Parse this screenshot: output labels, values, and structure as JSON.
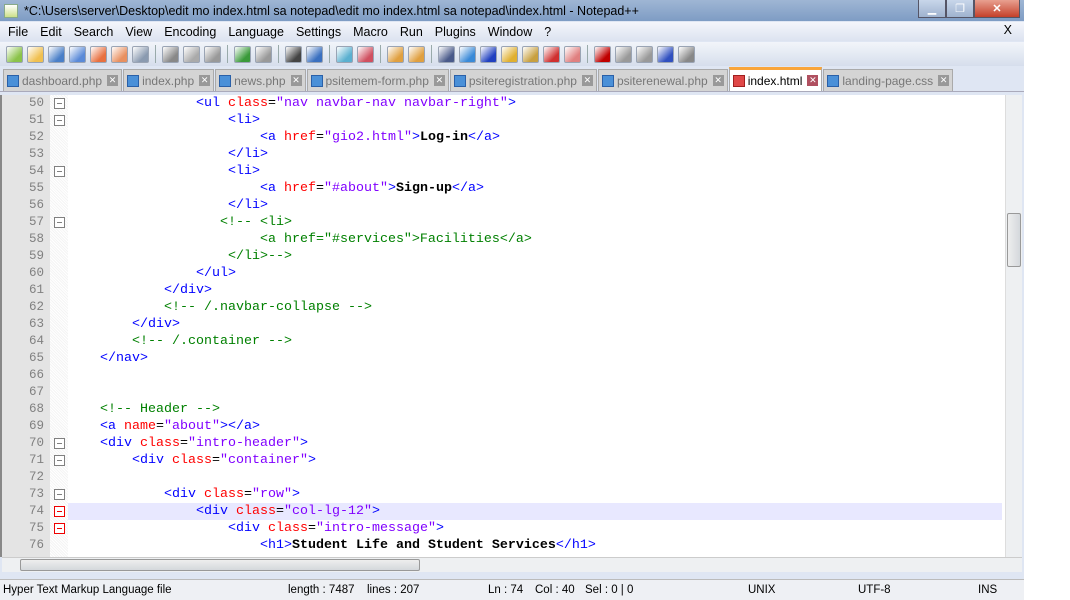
{
  "window": {
    "title": "*C:\\Users\\server\\Desktop\\edit mo index.html sa notepad\\edit mo index.html sa notepad\\index.html - Notepad++",
    "min": "▁",
    "max": "❐",
    "close": "✕"
  },
  "menu": [
    "File",
    "Edit",
    "Search",
    "View",
    "Encoding",
    "Language",
    "Settings",
    "Macro",
    "Run",
    "Plugins",
    "Window",
    "?"
  ],
  "menu_close": "X",
  "toolbar": [
    "new-file-icon",
    "open-file-icon",
    "save-icon",
    "save-all-icon",
    "close-icon",
    "close-all-icon",
    "print-icon",
    "|",
    "cut-icon",
    "copy-icon",
    "paste-icon",
    "|",
    "undo-icon",
    "redo-icon",
    "|",
    "find-icon",
    "replace-icon",
    "|",
    "zoom-in-icon",
    "zoom-out-icon",
    "|",
    "sync-vertical-icon",
    "sync-horizontal-icon",
    "|",
    "word-wrap-icon",
    "show-all-chars-icon",
    "indent-guide-icon",
    "user-lang-icon",
    "doc-map-icon",
    "function-list-icon",
    "folder-workspace-icon",
    "|",
    "record-macro-icon",
    "stop-record-icon",
    "play-macro-icon",
    "run-macro-multiple-icon",
    "save-macro-icon"
  ],
  "tabs": [
    {
      "label": "dashboard.php"
    },
    {
      "label": "index.php"
    },
    {
      "label": "news.php"
    },
    {
      "label": "psitemem-form.php"
    },
    {
      "label": "psiteregistration.php"
    },
    {
      "label": "psiterenewal.php"
    },
    {
      "label": "index.html",
      "active": true
    },
    {
      "label": "landing-page.css"
    }
  ],
  "editor": {
    "current_line": 74,
    "lines": [
      {
        "n": "50",
        "f": "m",
        "s": [
          [
            "e",
            "                "
          ],
          [
            "t",
            "<ul "
          ],
          [
            "a",
            "class"
          ],
          [
            "e",
            "="
          ],
          [
            "v",
            "\"nav navbar-nav navbar-right\""
          ],
          [
            "t",
            ">"
          ]
        ]
      },
      {
        "n": "51",
        "f": "m",
        "s": [
          [
            "e",
            "                    "
          ],
          [
            "t",
            "<li>"
          ]
        ]
      },
      {
        "n": "52",
        "f": "",
        "s": [
          [
            "e",
            "                        "
          ],
          [
            "t",
            "<a "
          ],
          [
            "a",
            "href"
          ],
          [
            "e",
            "="
          ],
          [
            "v",
            "\"gio2.html\""
          ],
          [
            "t",
            ">"
          ],
          [
            "x",
            "Log-in"
          ],
          [
            "t",
            "</a>"
          ]
        ]
      },
      {
        "n": "53",
        "f": "",
        "s": [
          [
            "e",
            "                    "
          ],
          [
            "t",
            "</li>"
          ]
        ]
      },
      {
        "n": "54",
        "f": "m",
        "s": [
          [
            "e",
            "                    "
          ],
          [
            "t",
            "<li>"
          ]
        ]
      },
      {
        "n": "55",
        "f": "",
        "s": [
          [
            "e",
            "                        "
          ],
          [
            "t",
            "<a "
          ],
          [
            "a",
            "href"
          ],
          [
            "e",
            "="
          ],
          [
            "v",
            "\"#about\""
          ],
          [
            "t",
            ">"
          ],
          [
            "x",
            "Sign-up"
          ],
          [
            "t",
            "</a>"
          ]
        ]
      },
      {
        "n": "56",
        "f": "",
        "s": [
          [
            "e",
            "                    "
          ],
          [
            "t",
            "</li>"
          ]
        ]
      },
      {
        "n": "57",
        "f": "m",
        "s": [
          [
            "e",
            "                   "
          ],
          [
            "c",
            "<!-- <li>"
          ]
        ]
      },
      {
        "n": "58",
        "f": "",
        "s": [
          [
            "e",
            "                        "
          ],
          [
            "c",
            "<a href=\"#services\">Facilities</a>"
          ]
        ]
      },
      {
        "n": "59",
        "f": "",
        "s": [
          [
            "e",
            "                    "
          ],
          [
            "c",
            "</li>-->"
          ]
        ]
      },
      {
        "n": "60",
        "f": "",
        "s": [
          [
            "e",
            "                "
          ],
          [
            "t",
            "</ul>"
          ]
        ]
      },
      {
        "n": "61",
        "f": "",
        "s": [
          [
            "e",
            "            "
          ],
          [
            "t",
            "</div>"
          ]
        ]
      },
      {
        "n": "62",
        "f": "",
        "s": [
          [
            "e",
            "            "
          ],
          [
            "c",
            "<!-- /.navbar-collapse -->"
          ]
        ]
      },
      {
        "n": "63",
        "f": "",
        "s": [
          [
            "e",
            "        "
          ],
          [
            "t",
            "</div>"
          ]
        ]
      },
      {
        "n": "64",
        "f": "",
        "s": [
          [
            "e",
            "        "
          ],
          [
            "c",
            "<!-- /.container -->"
          ]
        ]
      },
      {
        "n": "65",
        "f": "",
        "s": [
          [
            "e",
            "    "
          ],
          [
            "t",
            "</nav>"
          ]
        ]
      },
      {
        "n": "66",
        "f": "",
        "s": []
      },
      {
        "n": "67",
        "f": "",
        "s": []
      },
      {
        "n": "68",
        "f": "",
        "s": [
          [
            "e",
            "    "
          ],
          [
            "c",
            "<!-- Header -->"
          ]
        ]
      },
      {
        "n": "69",
        "f": "",
        "s": [
          [
            "e",
            "    "
          ],
          [
            "t",
            "<a "
          ],
          [
            "a",
            "name"
          ],
          [
            "e",
            "="
          ],
          [
            "v",
            "\"about\""
          ],
          [
            "t",
            "></a>"
          ]
        ]
      },
      {
        "n": "70",
        "f": "m",
        "s": [
          [
            "e",
            "    "
          ],
          [
            "t",
            "<div "
          ],
          [
            "a",
            "class"
          ],
          [
            "e",
            "="
          ],
          [
            "v",
            "\"intro-header\""
          ],
          [
            "t",
            ">"
          ]
        ]
      },
      {
        "n": "71",
        "f": "m",
        "s": [
          [
            "e",
            "        "
          ],
          [
            "t",
            "<div "
          ],
          [
            "a",
            "class"
          ],
          [
            "e",
            "="
          ],
          [
            "v",
            "\"container\""
          ],
          [
            "t",
            ">"
          ]
        ]
      },
      {
        "n": "72",
        "f": "",
        "s": []
      },
      {
        "n": "73",
        "f": "m",
        "s": [
          [
            "e",
            "            "
          ],
          [
            "t",
            "<div "
          ],
          [
            "a",
            "class"
          ],
          [
            "e",
            "="
          ],
          [
            "v",
            "\"row\""
          ],
          [
            "t",
            ">"
          ]
        ]
      },
      {
        "n": "74",
        "f": "r",
        "s": [
          [
            "e",
            "                "
          ],
          [
            "t",
            "<div "
          ],
          [
            "a",
            "class"
          ],
          [
            "e",
            "="
          ],
          [
            "v",
            "\"col-lg-12\""
          ],
          [
            "t",
            ">"
          ]
        ]
      },
      {
        "n": "75",
        "f": "r",
        "s": [
          [
            "e",
            "                    "
          ],
          [
            "t",
            "<div "
          ],
          [
            "a",
            "class"
          ],
          [
            "e",
            "="
          ],
          [
            "v",
            "\"intro-message\""
          ],
          [
            "t",
            ">"
          ]
        ]
      },
      {
        "n": "76",
        "f": "",
        "s": [
          [
            "e",
            "                        "
          ],
          [
            "t",
            "<h1>"
          ],
          [
            "x",
            "Student Life and Student Services"
          ],
          [
            "t",
            "</h1>"
          ]
        ]
      }
    ]
  },
  "status": {
    "file_type": "Hyper Text Markup Language file",
    "length": "length : 7487",
    "lines": "lines : 207",
    "ln": "Ln : 74",
    "col": "Col : 40",
    "sel": "Sel : 0 | 0",
    "eol": "UNIX",
    "encoding": "UTF-8",
    "mode": "INS"
  },
  "colors": {
    "tag": "#0000ff",
    "attribute": "#ff0000",
    "value": "#8000ff",
    "comment": "#008000",
    "current_line": "#e8e8ff",
    "active_tab_accent": "#f9a53a"
  }
}
